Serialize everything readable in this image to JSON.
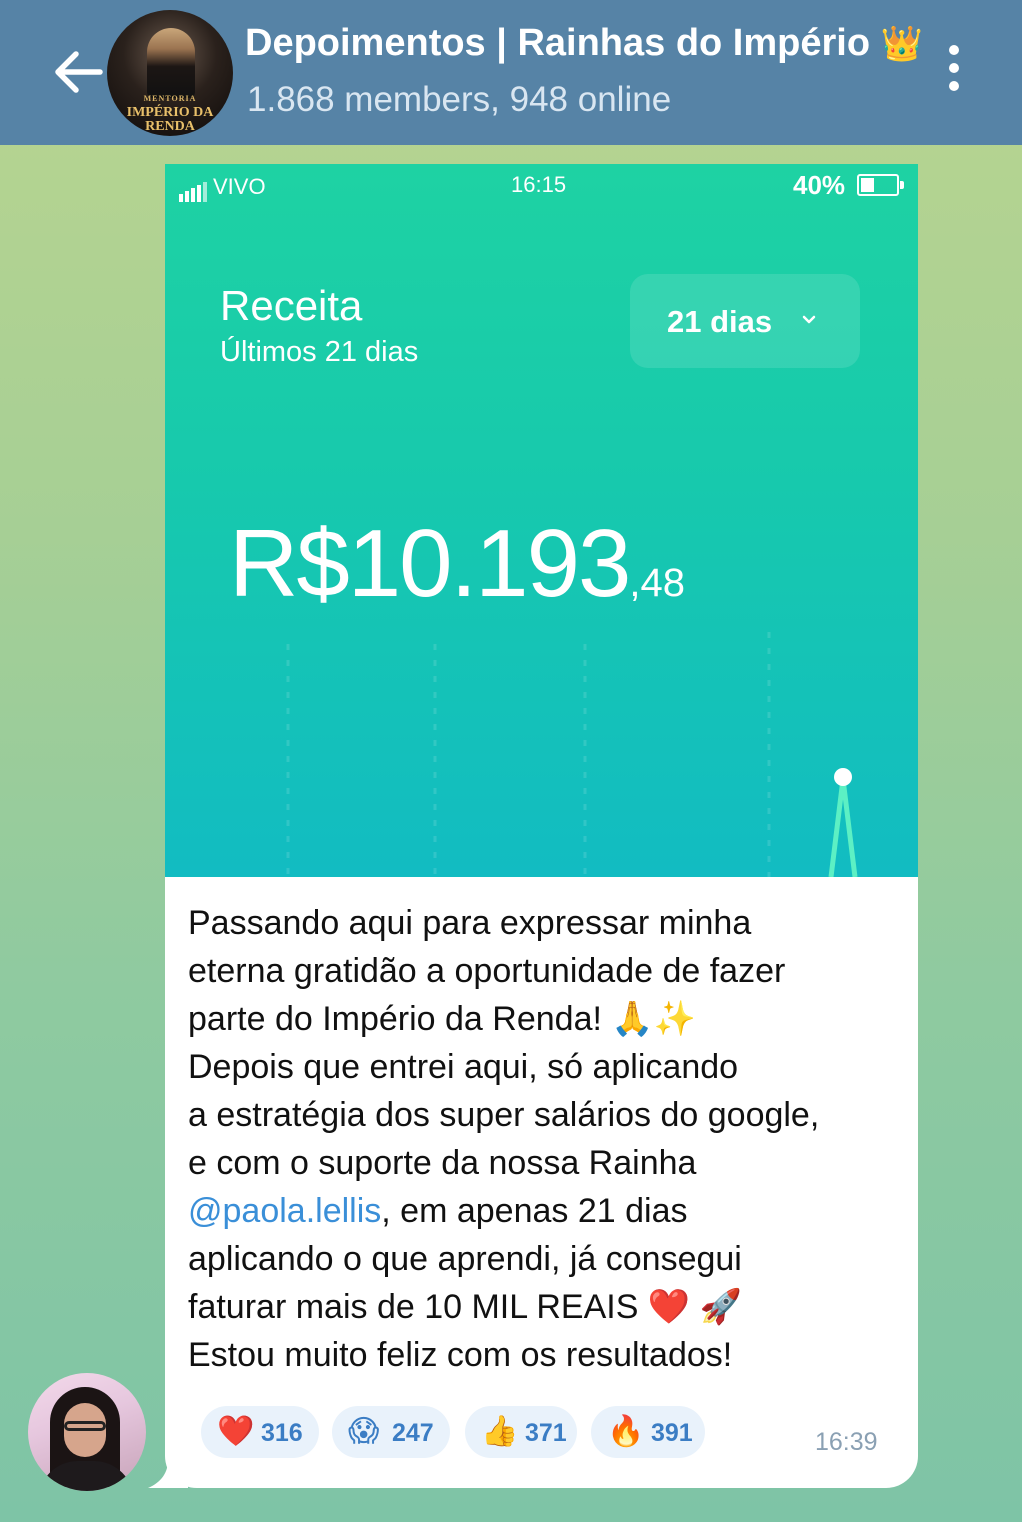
{
  "header": {
    "title": "Depoimentos | Rainhas do Império",
    "title_emoji": "👑",
    "subtitle": "1.868 members, 948 online",
    "avatar_text": "IMPÉRIO DA RENDA",
    "avatar_small_text": "MENTORIA"
  },
  "screenshot": {
    "carrier": "VIVO",
    "time": "16:15",
    "battery": "40%",
    "title": "Receita",
    "subtitle": "Últimos 21 dias",
    "period": "21 dias",
    "amount_main": "R$10.193",
    "amount_cents": ",48"
  },
  "message": {
    "lines": [
      "Passando aqui para expressar minha",
      "eterna gratidão a oportunidade de fazer",
      "parte do Império da Renda! 🙏✨",
      "Depois que entrei aqui, só aplicando",
      "a estratégia dos super salários do google,",
      "e com o suporte da nossa Rainha",
      ", em apenas 21 dias",
      "aplicando o que aprendi, já consegui",
      "faturar mais de 10 MIL REAIS ❤️ 🚀",
      "Estou muito feliz com os resultados!"
    ],
    "mention": "@paola.lellis",
    "time": "16:39"
  },
  "reactions": [
    {
      "emoji": "❤️",
      "count": "316"
    },
    {
      "emoji": "😱",
      "count": "247"
    },
    {
      "emoji": "👍",
      "count": "371"
    },
    {
      "emoji": "🔥",
      "count": "391"
    }
  ],
  "colors": {
    "header_bg": "#5683a6",
    "screenshot_green": "#1ed2a3",
    "mention": "#3a8fd8",
    "reaction_text": "#3b7dc4"
  }
}
